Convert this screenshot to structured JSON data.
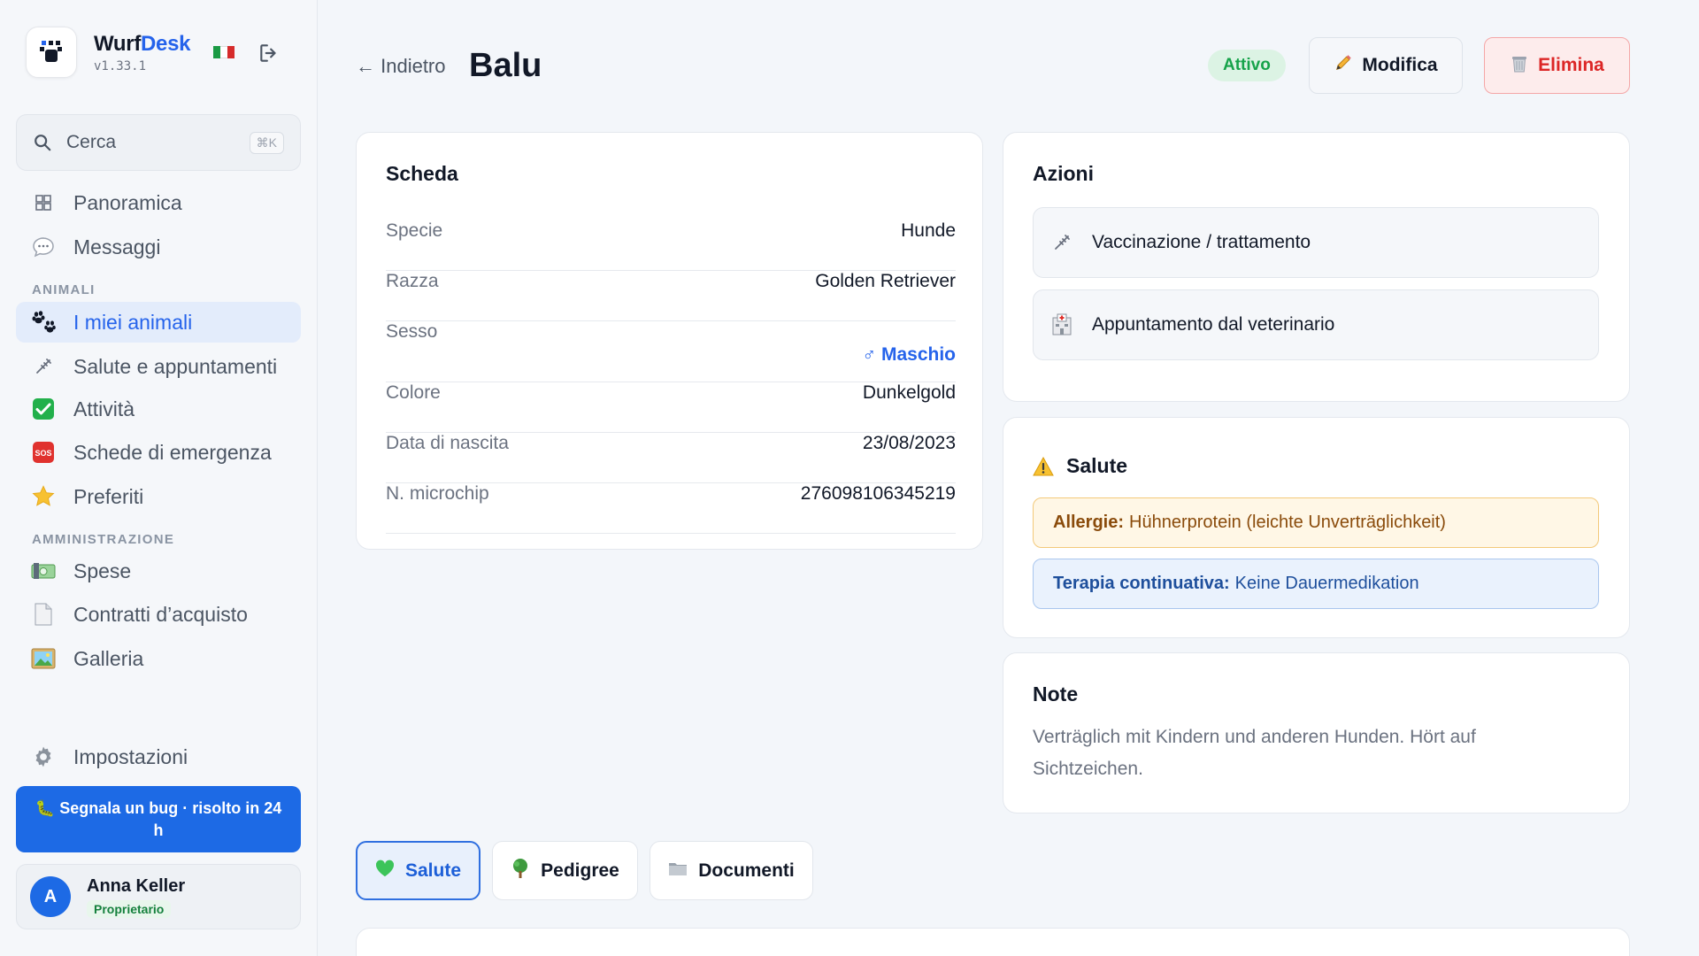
{
  "app": {
    "name_part1": "Wurf",
    "name_part2": "Desk",
    "version": "v1.33.1"
  },
  "search": {
    "label": "Cerca",
    "shortcut": "⌘K"
  },
  "sidebar": {
    "items": [
      {
        "label": "Panoramica",
        "icon": "grid-icon"
      },
      {
        "label": "Messaggi",
        "icon": "speech-bubble-icon"
      },
      {
        "label": "I miei animali",
        "icon": "paw-prints-icon",
        "active": true
      },
      {
        "label": "Salute e appuntamenti",
        "icon": "syringe-icon"
      },
      {
        "label": "Attività",
        "icon": "check-mark-icon"
      },
      {
        "label": "Schede di emergenza",
        "icon": "sos-icon"
      },
      {
        "label": "Preferiti",
        "icon": "star-icon"
      },
      {
        "label": "Spese",
        "icon": "money-icon"
      },
      {
        "label": "Contratti d’acquisto",
        "icon": "document-icon"
      },
      {
        "label": "Galleria",
        "icon": "picture-icon"
      },
      {
        "label": "Impostazioni",
        "icon": "gear-icon"
      }
    ],
    "sections": {
      "animals": "ANIMALI",
      "admin": "AMMINISTRAZIONE"
    },
    "bug_button": "🐛 Segnala un bug · risolto in 24 h",
    "user": {
      "initial": "A",
      "name": "Anna Keller",
      "role": "Proprietario"
    }
  },
  "header": {
    "back_label": "← Indietro",
    "title": "Balu",
    "status": "Attivo",
    "edit_label": "Modifica",
    "delete_label": "Elimina"
  },
  "profile": {
    "title": "Scheda",
    "rows": [
      {
        "key": "Specie",
        "value": "Hunde"
      },
      {
        "key": "Razza",
        "value": "Golden Retriever"
      },
      {
        "key": "Sesso",
        "value": "♂ Maschio"
      },
      {
        "key": "Colore",
        "value": "Dunkelgold"
      },
      {
        "key": "Data di nascita",
        "value": "23/08/2023"
      },
      {
        "key": "N. microchip",
        "value": "276098106345219"
      }
    ]
  },
  "actions": {
    "title": "Azioni",
    "items": [
      {
        "label": "Vaccinazione / trattamento",
        "icon": "syringe-icon"
      },
      {
        "label": "Appuntamento dal veterinario",
        "icon": "hospital-icon"
      }
    ]
  },
  "health": {
    "title": "Salute",
    "allergy_label": "Allergie:",
    "allergy_value": "Hühnerprotein (leichte Unverträglichkeit)",
    "therapy_label": "Terapia continuativa:",
    "therapy_value": "Keine Dauermedikation"
  },
  "notes": {
    "title": "Note",
    "text": "Verträglich mit Kindern und anderen Hunden. Hört auf Sichtzeichen."
  },
  "tabs": [
    {
      "label": "Salute",
      "icon": "green-heart-icon",
      "active": true
    },
    {
      "label": "Pedigree",
      "icon": "tree-icon"
    },
    {
      "label": "Documenti",
      "icon": "folder-icon"
    }
  ],
  "colors": {
    "accent": "#2563eb",
    "danger": "#dc2626",
    "success": "#16a34a"
  }
}
